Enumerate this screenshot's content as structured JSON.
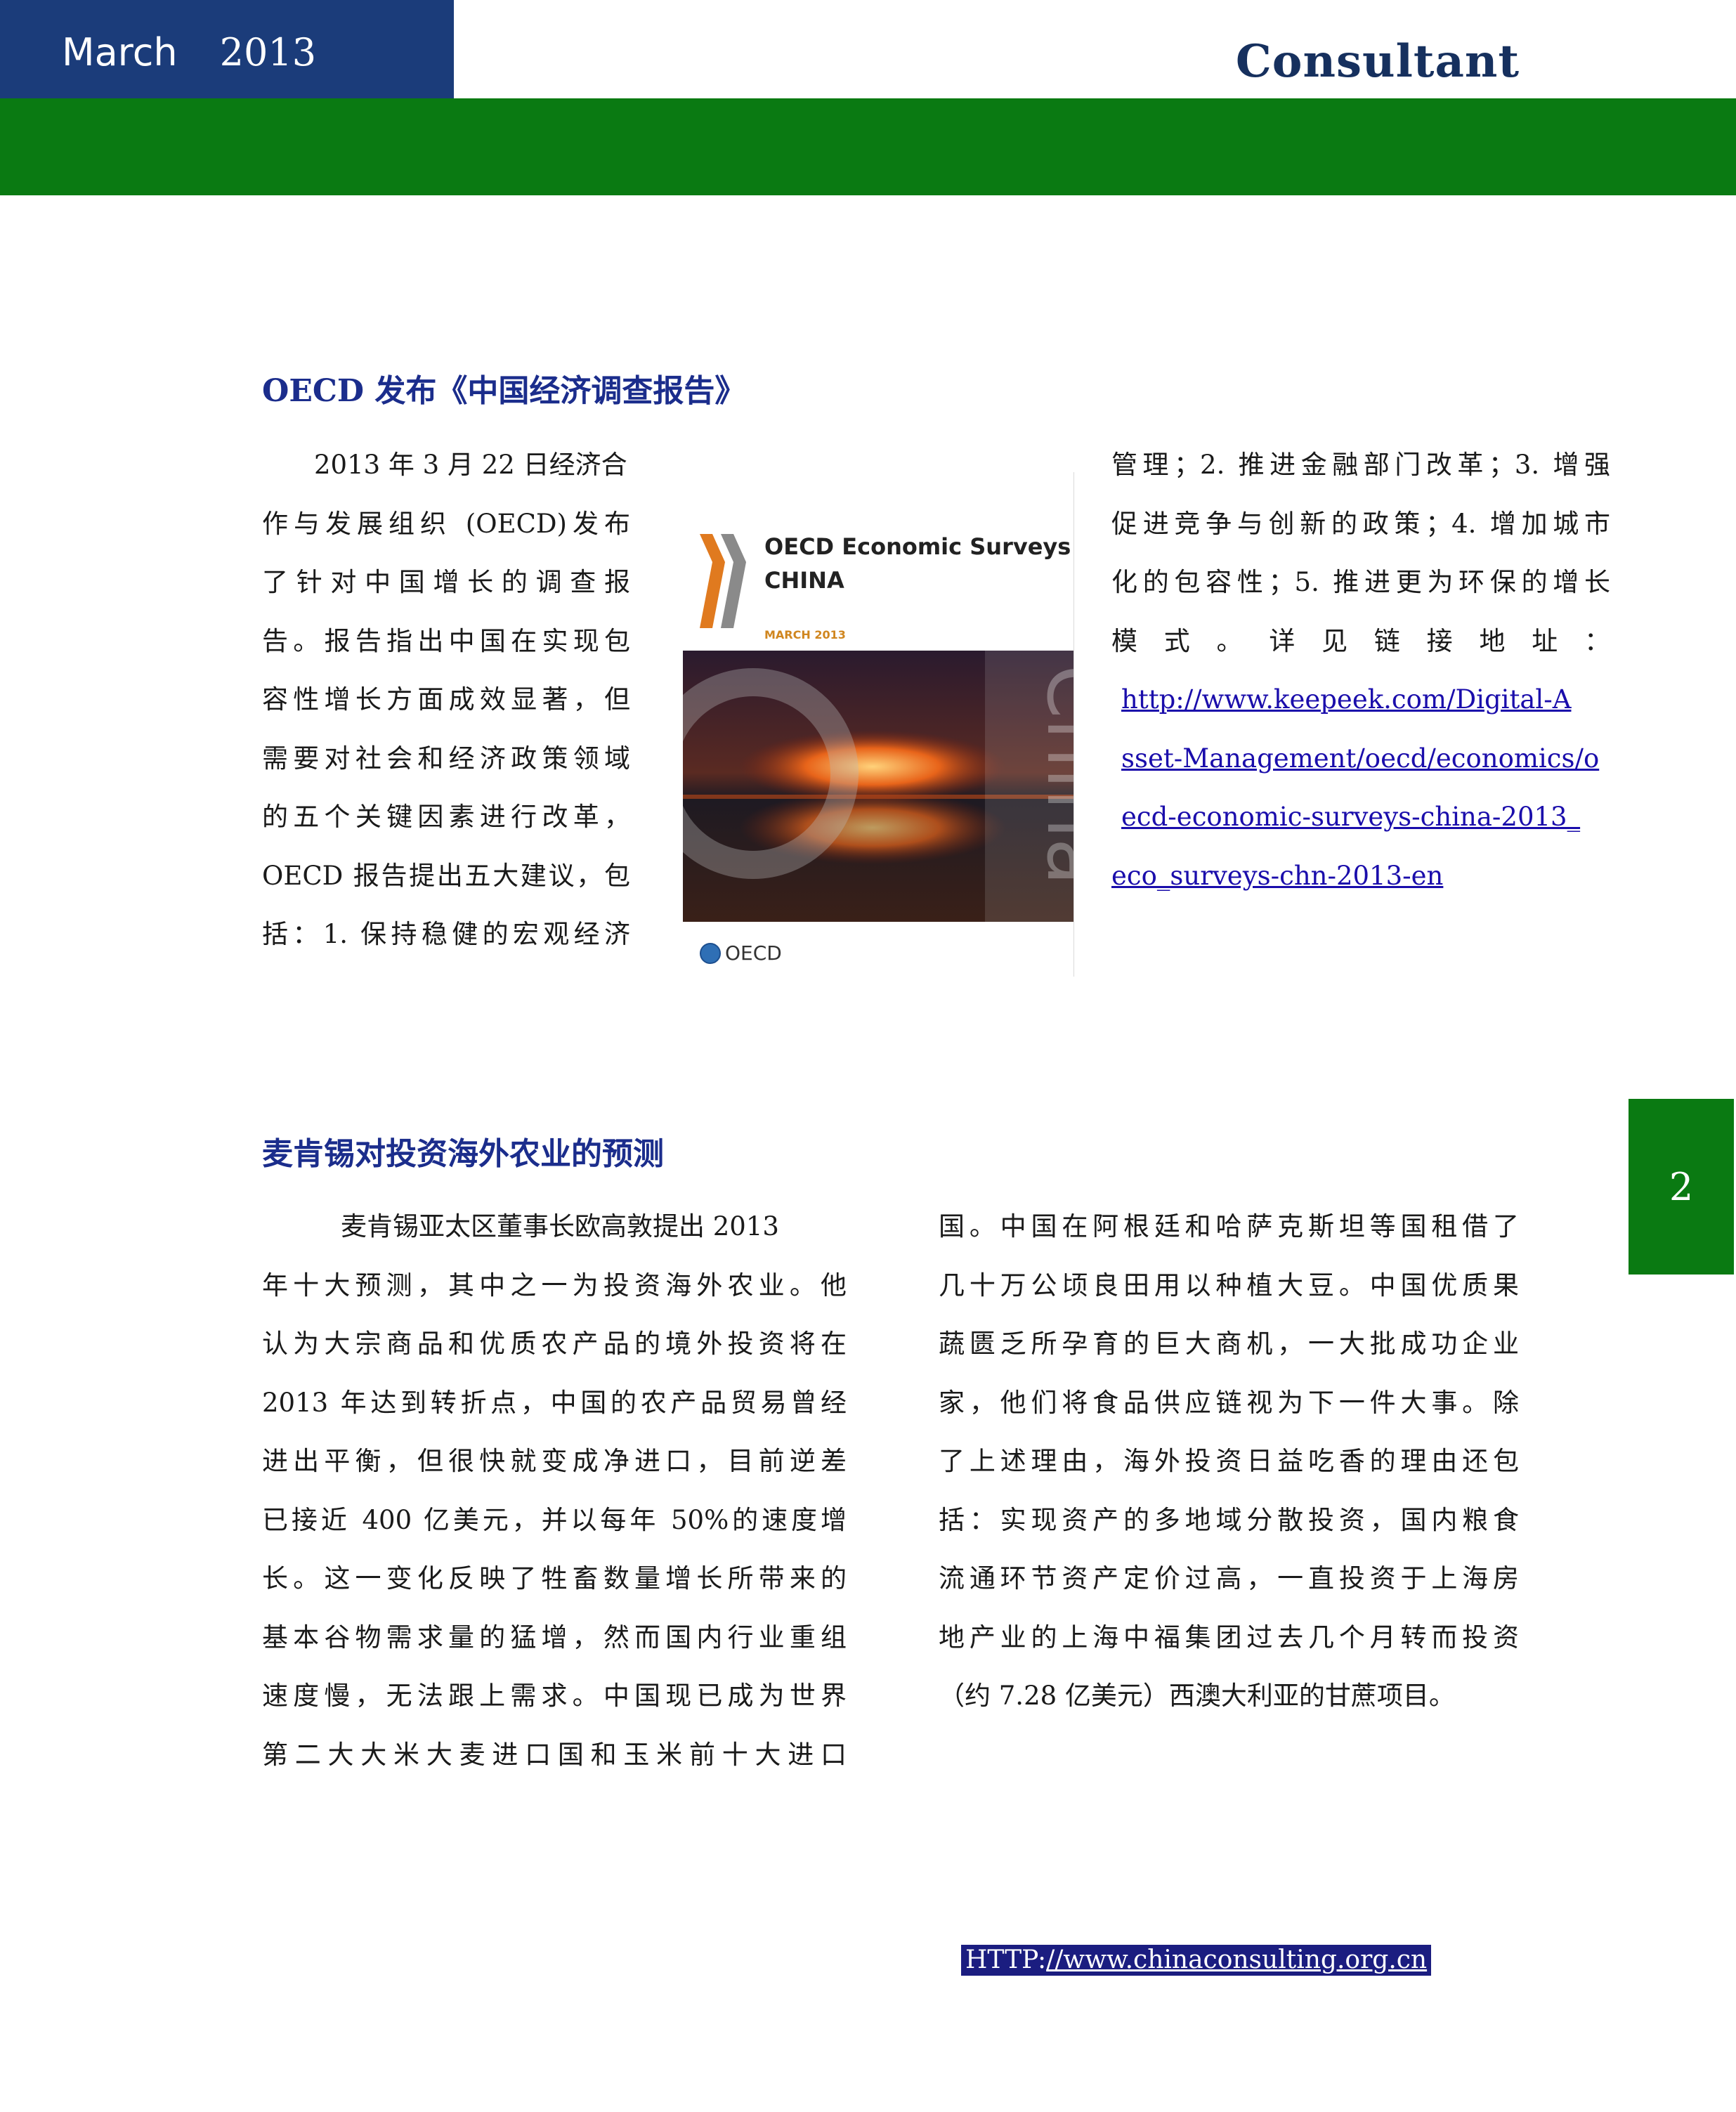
{
  "header": {
    "month": "March",
    "year": "2013",
    "brand": "Consultant"
  },
  "article1": {
    "title": "OECD 发布《中国经济调查报告》",
    "left_lines": [
      "2013 年 3 月 22 日经济合",
      "作与发展组织 (OECD)发布",
      "了针对中国增长的调查报",
      "告。报告指出中国在实现包",
      "容性增长方面成效显著，但",
      "需要对社会和经济政策领域",
      "的五个关键因素进行改革，",
      "OECD 报告提出五大建议，包",
      "括：1. 保持稳健的宏观经济"
    ],
    "right_lines": [
      "管理；2. 推进金融部门改革；3. 增强",
      "促进竞争与创新的政策；4. 增加城市",
      "化的包容性；5. 推进更为环保的增长",
      "模 式 。 详 见 链 接 地 址 ："
    ],
    "link_lines": [
      "http://www.keepeek.com/Digital-A",
      "sset-Management/oecd/economics/o",
      "ecd-economic-surveys-china-2013_",
      "eco_surveys-chn-2013-en"
    ]
  },
  "cover": {
    "title_line1": "OECD Economic Surveys",
    "title_line2": "CHINA",
    "date": "MARCH 2013",
    "spine_text": "China",
    "logo_text": "OECD",
    "colors": {
      "chevron_orange": "#e07a1f",
      "chevron_gray": "#8a8a8a",
      "photo_orange": "#e8641a"
    }
  },
  "article2": {
    "title": "麦肯锡对投资海外农业的预测",
    "left_lines": [
      "麦肯锡亚太区董事长欧高敦提出 2013",
      "年十大预测，其中之一为投资海外农业。他",
      "认为大宗商品和优质农产品的境外投资将在",
      "2013 年达到转折点，中国的农产品贸易曾经",
      "进出平衡，但很快就变成净进口，目前逆差",
      "已接近 400 亿美元，并以每年 50%的速度增",
      "长。这一变化反映了牲畜数量增长所带来的",
      "基本谷物需求量的猛增，然而国内行业重组",
      "速度慢，无法跟上需求。中国现已成为世界",
      "第二大大米大麦进口国和玉米前十大进口"
    ],
    "right_lines": [
      "国。中国在阿根廷和哈萨克斯坦等国租借了",
      "几十万公顷良田用以种植大豆。中国优质果",
      "蔬匮乏所孕育的巨大商机，一大批成功企业",
      "家，他们将食品供应链视为下一件大事。除",
      "了上述理由，海外投资日益吃香的理由还包",
      "括：实现资产的多地域分散投资，国内粮食",
      "流通环节资产定价过高，一直投资于上海房",
      "地产业的上海中福集团过去几个月转而投资",
      "（约 7.28 亿美元）西澳大利亚的甘蔗项目。"
    ]
  },
  "page_number": "2",
  "footer": {
    "prefix": "HTTP:",
    "url": "//www.chinaconsulting.org.cn"
  },
  "colors": {
    "header_blue": "#1b3c7a",
    "green_bar": "#0a7a12",
    "title_blue": "#1b2d8c",
    "footer_bg": "#1b1d80"
  }
}
